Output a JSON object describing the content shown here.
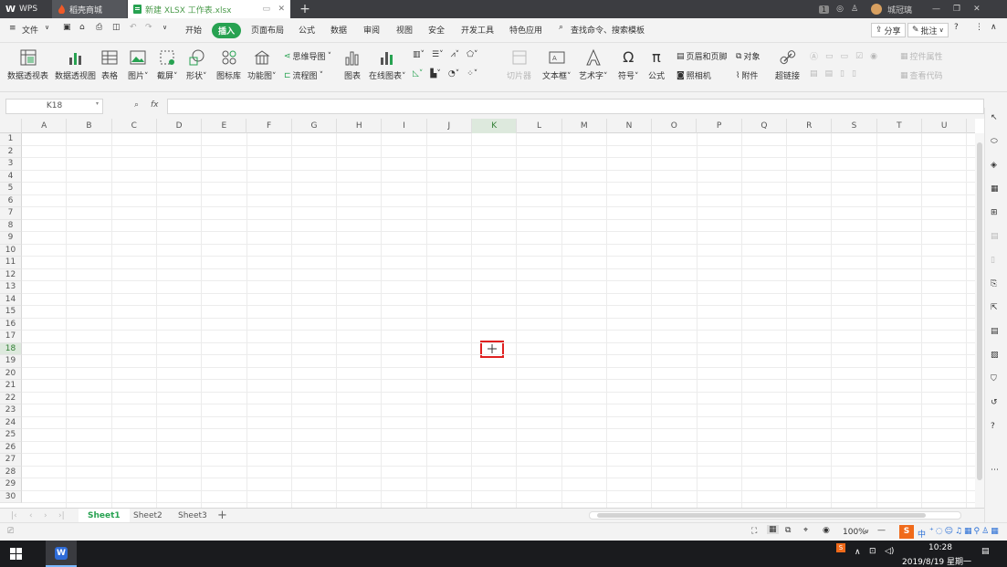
{
  "titlebar": {
    "tabs": [
      {
        "label": "WPS"
      },
      {
        "label": "稻壳商城"
      },
      {
        "label": "新建 XLSX 工作表.xlsx"
      }
    ],
    "page_badge": "1",
    "user_name": "城冠璃"
  },
  "menu": {
    "file": "文件",
    "items": [
      "开始",
      "插入",
      "页面布局",
      "公式",
      "数据",
      "审阅",
      "视图",
      "安全",
      "开发工具",
      "特色应用"
    ],
    "search": "查找命令、搜索模板",
    "share": "分享",
    "comment": "批注"
  },
  "ribbon": {
    "big": [
      "数据透视表",
      "数据透视图",
      "表格",
      "图片",
      "截屏",
      "形状",
      "图标库",
      "功能图",
      "图表",
      "在线图表",
      "切片器",
      "文本框",
      "艺术字",
      "符号",
      "公式",
      "超链接"
    ],
    "mindmap": "思维导图",
    "flowchart": "流程图",
    "header_footer": "页眉和页脚",
    "camera": "照相机",
    "object": "对象",
    "attachment": "附件",
    "control_props": "控件属性",
    "view_code": "查看代码"
  },
  "formula": {
    "namebox": "K18",
    "fx": "fx",
    "value": ""
  },
  "grid": {
    "columns": [
      "A",
      "B",
      "C",
      "D",
      "E",
      "F",
      "G",
      "H",
      "I",
      "J",
      "K",
      "L",
      "M",
      "N",
      "O",
      "P",
      "Q",
      "R",
      "S",
      "T",
      "U"
    ],
    "rows": [
      "1",
      "2",
      "3",
      "4",
      "5",
      "6",
      "7",
      "8",
      "9",
      "10",
      "11",
      "12",
      "13",
      "14",
      "15",
      "16",
      "17",
      "18",
      "19",
      "20",
      "21",
      "22",
      "23",
      "24",
      "25",
      "26",
      "27",
      "28",
      "29",
      "30"
    ],
    "active_column": "K",
    "active_row": "18"
  },
  "sheets": [
    "Sheet1",
    "Sheet2",
    "Sheet3"
  ],
  "active_sheet": "Sheet1",
  "status": {
    "zoom": "100%",
    "ime": "中"
  },
  "taskbar": {
    "time": "10:28",
    "date": "2019/8/19 星期一"
  },
  "colors": {
    "accent": "#27a251",
    "highlight": "#e02020"
  }
}
